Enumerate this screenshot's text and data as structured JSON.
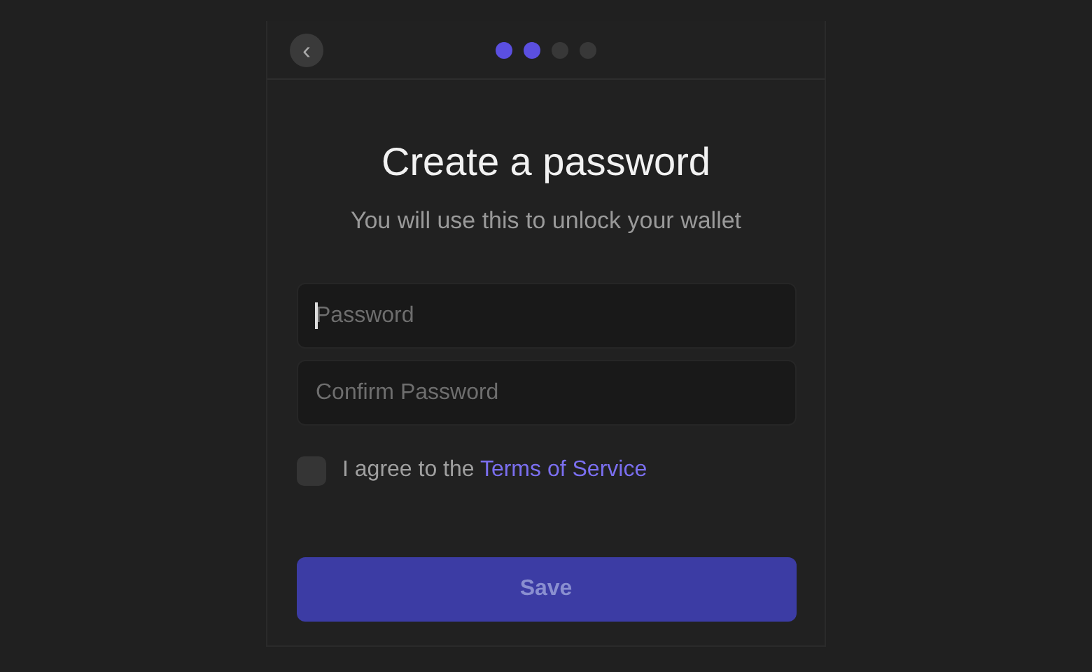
{
  "header": {
    "back_button": {
      "label": "‹"
    },
    "steps": [
      {
        "active": true
      },
      {
        "active": true
      },
      {
        "active": false
      },
      {
        "active": false
      }
    ]
  },
  "title": "Create a password",
  "subtitle": "You will use this to unlock your wallet",
  "fields": [
    {
      "placeholder": "Password",
      "focused": true
    },
    {
      "placeholder": "Confirm Password",
      "focused": false
    }
  ],
  "agreement": {
    "checked": false,
    "text": "I agree to the",
    "link": "Terms of Service"
  },
  "save_button": {
    "label": "Save",
    "disabled": true
  }
}
